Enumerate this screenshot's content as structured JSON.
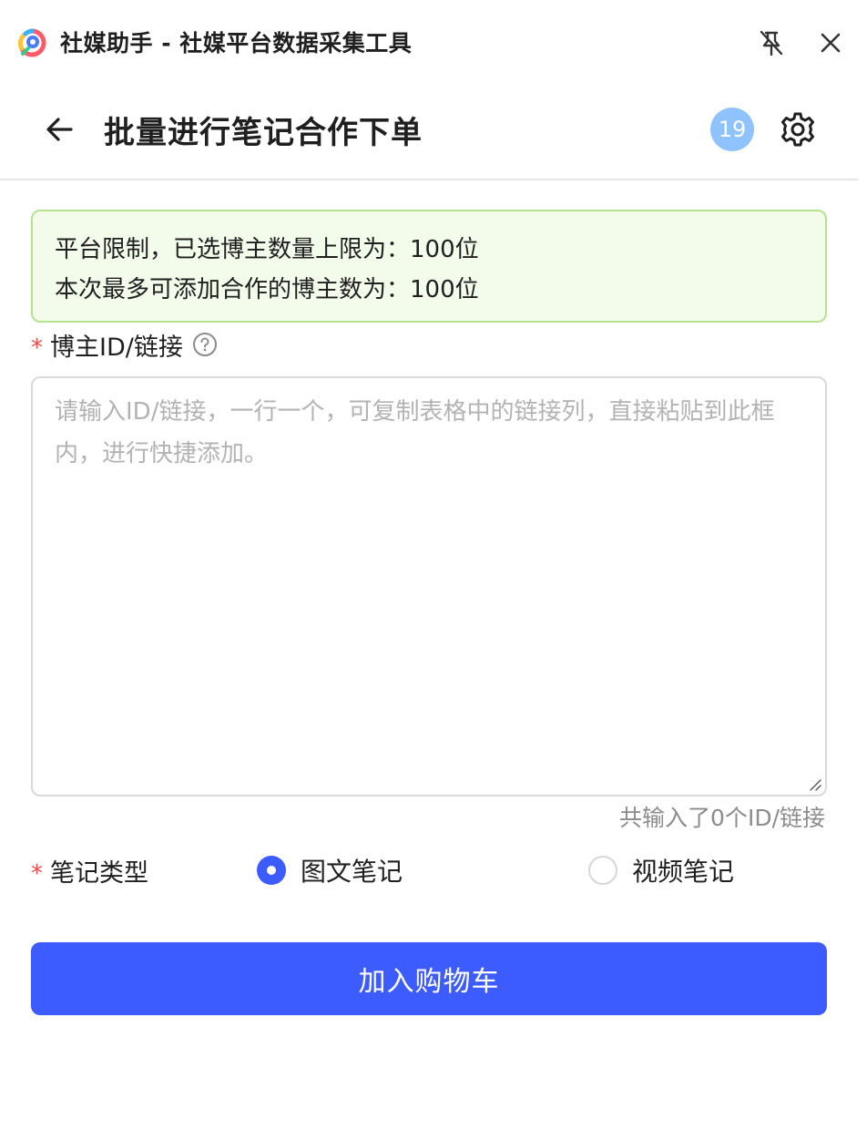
{
  "window": {
    "title": "社媒助手 - 社媒平台数据采集工具",
    "icons": {
      "logo": "app-logo",
      "pin": "unpin-icon",
      "close": "close-icon"
    }
  },
  "header": {
    "title": "批量进行笔记合作下单",
    "badge_count": "19",
    "icons": {
      "back": "arrow-left-icon",
      "settings": "gear-icon"
    }
  },
  "notice": {
    "line1": "平台限制，已选博主数量上限为：100位",
    "line2": "本次最多可添加合作的博主数为：100位"
  },
  "form": {
    "creator_field": {
      "required_mark": "*",
      "label": "博主ID/链接",
      "value": "",
      "placeholder": "请输入ID/链接，一行一个，可复制表格中的链接列，直接粘贴到此框内，进行快捷添加。",
      "counter": "共输入了0个ID/链接"
    },
    "note_type": {
      "required_mark": "*",
      "label": "笔记类型",
      "options": [
        {
          "label": "图文笔记",
          "checked": true
        },
        {
          "label": "视频笔记",
          "checked": false
        }
      ]
    },
    "submit_label": "加入购物车"
  },
  "colors": {
    "primary": "#3d5cff",
    "notice_bg": "#f3fbea",
    "notice_border": "#b6e48e",
    "badge": "#8fc3ff",
    "required": "#f04b4b"
  }
}
